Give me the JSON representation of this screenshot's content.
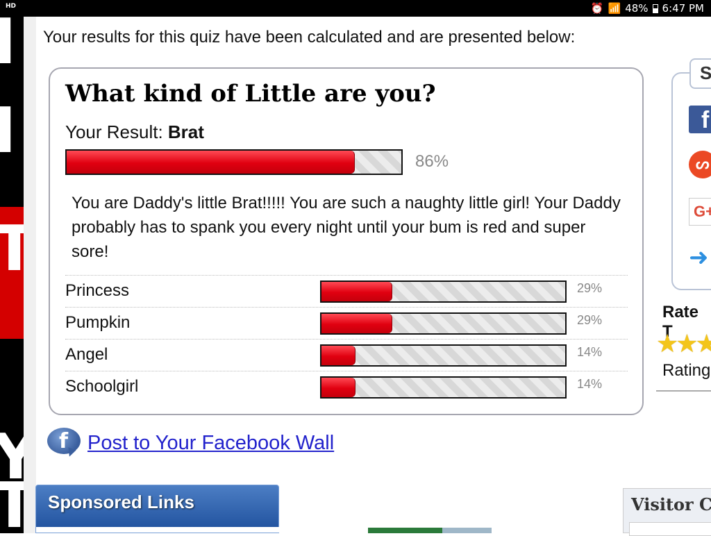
{
  "status_bar": {
    "left_badge": "HD",
    "battery": "48%",
    "time": "6:47 PM",
    "icons": [
      "alarm-icon",
      "wifi-icon",
      "battery-icon"
    ]
  },
  "intro_text": "Your results for this quiz have been calculated and are presented below:",
  "quiz": {
    "title": "What kind of Little are you?",
    "result_prefix": "Your Result: ",
    "result_name": "Brat",
    "result_percent": "86%",
    "result_fraction": 0.86,
    "description": "You are Daddy's little Brat!!!!! You are such a naughty little girl! Your Daddy probably has to spank you every night until your bum is red and super sore!",
    "other_results": [
      {
        "label": "Princess",
        "percent": "29%",
        "fraction": 0.29
      },
      {
        "label": "Pumpkin",
        "percent": "29%",
        "fraction": 0.29
      },
      {
        "label": "Angel",
        "percent": "14%",
        "fraction": 0.14
      },
      {
        "label": "Schoolgirl",
        "percent": "14%",
        "fraction": 0.14
      }
    ]
  },
  "facebook": {
    "link_text": "Post to Your Facebook Wall"
  },
  "sponsored": {
    "header": "Sponsored Links"
  },
  "sidebar": {
    "share_tab": "S",
    "share_icons": [
      "facebook-icon",
      "stumbleupon-icon",
      "google-plus-icon",
      "share-arrow-icon"
    ],
    "gplus_text": "G+",
    "fb_text": "f",
    "rate_label": "Rate T",
    "rating_label": "Rating",
    "visitor_header": "Visitor C"
  },
  "left_strip": {
    "glyphs": [
      "I",
      "I",
      "T",
      "Y",
      "T"
    ]
  },
  "colors": {
    "bar_fill": "#e00010",
    "link": "#2222cc",
    "sponsored_bg": "#1e4f9c",
    "star": "#f3c51b"
  }
}
